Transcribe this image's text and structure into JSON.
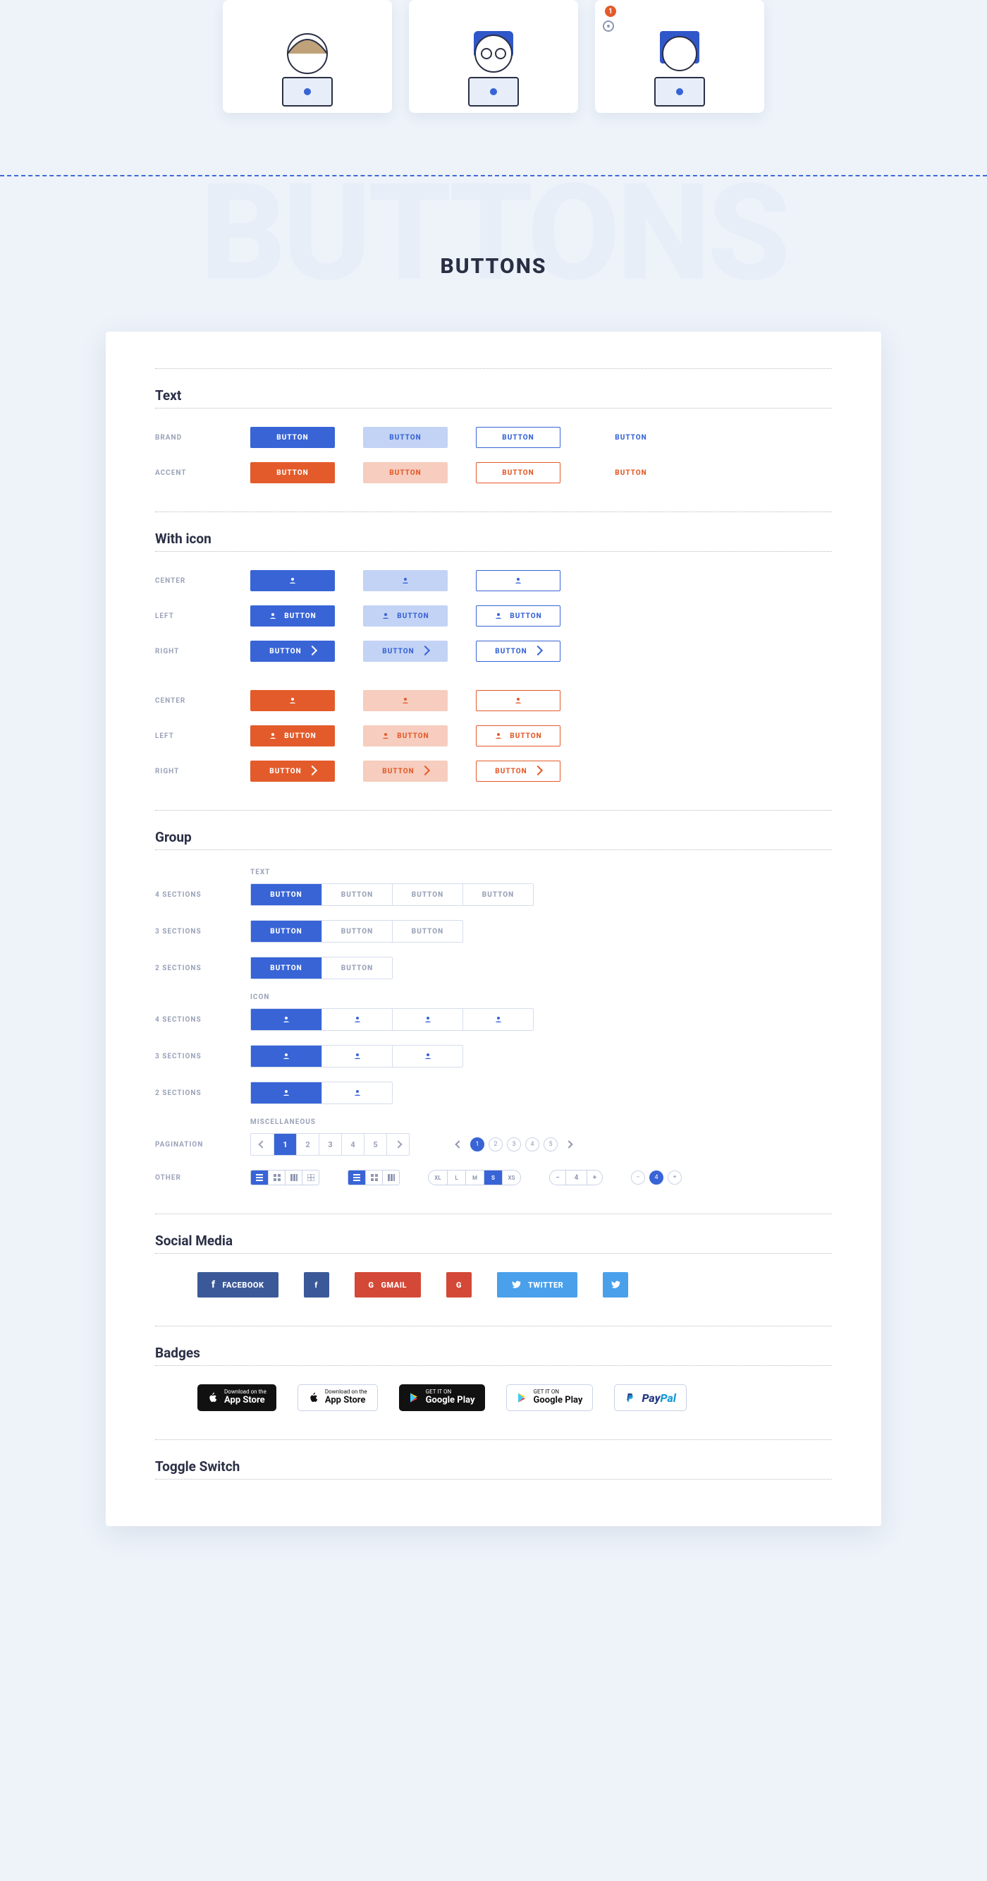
{
  "section_heading": "BUTTONS",
  "watermark": "BUTTONS",
  "sections": {
    "text": "Text",
    "with_icon": "With icon",
    "group": "Group",
    "social": "Social Media",
    "badges": "Badges",
    "toggle": "Toggle Switch"
  },
  "labels": {
    "brand": "BRAND",
    "accent": "ACCENT",
    "center": "CENTER",
    "left": "LEFT",
    "right": "RIGHT",
    "text_sub": "TEXT",
    "sec4": "4 SECTIONS",
    "sec3": "3 SECTIONS",
    "sec2": "2 SECTIONS",
    "icon_sub": "ICON",
    "misc": "MISCELLANEOUS",
    "pagination": "PAGINATION",
    "other": "OTHER"
  },
  "btn_label": "BUTTON",
  "pagination_square": [
    "1",
    "2",
    "3",
    "4",
    "5"
  ],
  "pagination_round": [
    "1",
    "2",
    "3",
    "4",
    "5"
  ],
  "size_pills": [
    "XL",
    "L",
    "M",
    "S",
    "XS"
  ],
  "stepper_val": "4",
  "round_sel": "4",
  "social_buttons": {
    "facebook": "FACEBOOK",
    "gmail": "GMAIL",
    "twitter": "TWITTER"
  },
  "store_badges": {
    "app_small": "Download on the",
    "app_big": "App Store",
    "play_small": "GET IT ON",
    "play_big": "Google Play",
    "paypal_a": "Pay",
    "paypal_b": "Pal"
  },
  "avatar_badge": "1"
}
